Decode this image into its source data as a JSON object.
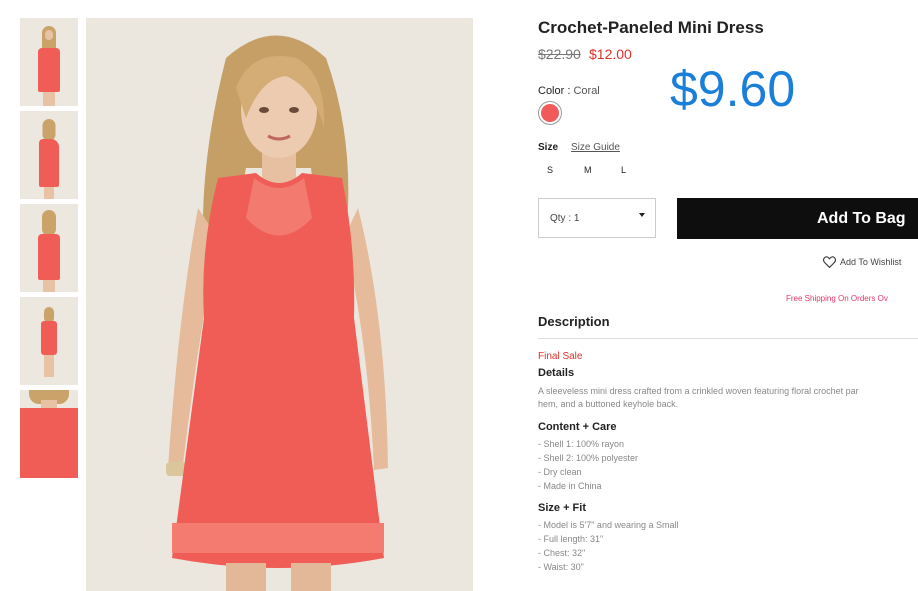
{
  "product": {
    "title": "Crochet-Paneled Mini Dress",
    "price_original": "$22.90",
    "price_sale": "$12.00",
    "price_overlay": "$9.60",
    "color_label": "Color",
    "color_value": "Coral",
    "swatch_color": "#f05a5b"
  },
  "size": {
    "label": "Size",
    "guide_link": "Size Guide",
    "options": [
      "S",
      "M",
      "L"
    ]
  },
  "qty": {
    "label": "Qty : 1"
  },
  "actions": {
    "add_to_bag": "Add To Bag",
    "wishlist": "Add To Wishlist"
  },
  "shipping_notice": "Free Shipping On Orders Ov",
  "description": {
    "heading": "Description",
    "final_sale": "Final Sale",
    "details_heading": "Details",
    "details_line1": "A sleeveless mini dress crafted from a crinkled woven featuring floral crochet par",
    "details_line2": "hem, and a buttoned keyhole back.",
    "care_heading": "Content + Care",
    "care_items": [
      "- Shell 1: 100% rayon",
      "- Shell 2: 100% polyester",
      "- Dry clean",
      "- Made in China"
    ],
    "fit_heading": "Size + Fit",
    "fit_items": [
      "- Model is 5'7\" and wearing a Small",
      "- Full length: 31\"",
      "- Chest: 32\"",
      "- Waist: 30\""
    ]
  },
  "colors": {
    "accent_sale": "#e0312b",
    "overlay_price": "#1a7fd8",
    "shipping_pink": "#e3386b",
    "dress_coral": "#ef5d56"
  }
}
